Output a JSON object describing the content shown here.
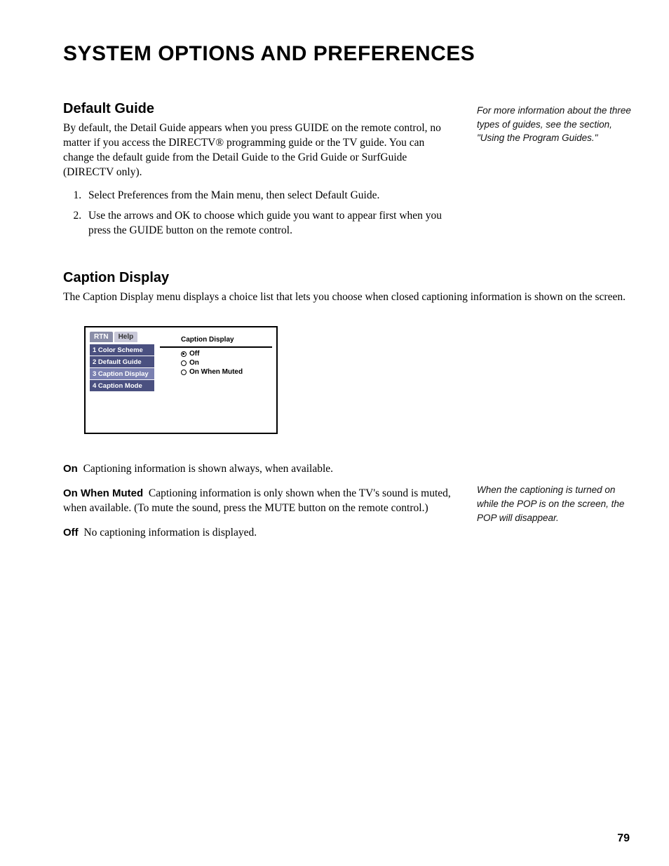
{
  "title": "SYSTEM OPTIONS AND PREFERENCES",
  "page_number": "79",
  "sections": {
    "default_guide": {
      "heading": "Default Guide",
      "intro": "By default, the Detail Guide appears when you press GUIDE on the remote control, no matter if you access the DIRECTV® programming guide or the TV guide. You can change the default guide from the Detail Guide to the Grid Guide or SurfGuide (DIRECTV only).",
      "steps": [
        "Select Preferences from the Main menu, then select Default Guide.",
        "Use the arrows and OK to choose which guide you want to appear first when you press the GUIDE button on the remote control."
      ],
      "sidenote": "For more information about the three types of guides, see the section, \"Using the Program Guides.\""
    },
    "caption_display": {
      "heading": "Caption Display",
      "intro": "The Caption Display menu displays a choice list that lets you choose when closed captioning information is shown on the screen.",
      "mock": {
        "tabs": [
          "RTN",
          "Help"
        ],
        "title": "Caption Display",
        "sidebar": [
          "1 Color Scheme",
          "2 Default Guide",
          "3 Caption Display",
          "4 Caption Mode"
        ],
        "selected_sidebar_index": 2,
        "options": [
          {
            "label": "Off",
            "selected": true
          },
          {
            "label": "On",
            "selected": false
          },
          {
            "label": "On When Muted",
            "selected": false
          }
        ]
      },
      "defs": {
        "on": {
          "term": "On",
          "text": "Captioning information is shown always, when available."
        },
        "on_when_muted": {
          "term": "On When Muted",
          "text": "Captioning information is only shown when the TV's sound is muted, when available. (To mute the sound, press the MUTE button on the remote control.)"
        },
        "off": {
          "term": "Off",
          "text": "No captioning information is displayed."
        }
      },
      "sidenote": "When the captioning is turned on while the POP is on the screen, the POP will disappear."
    }
  }
}
